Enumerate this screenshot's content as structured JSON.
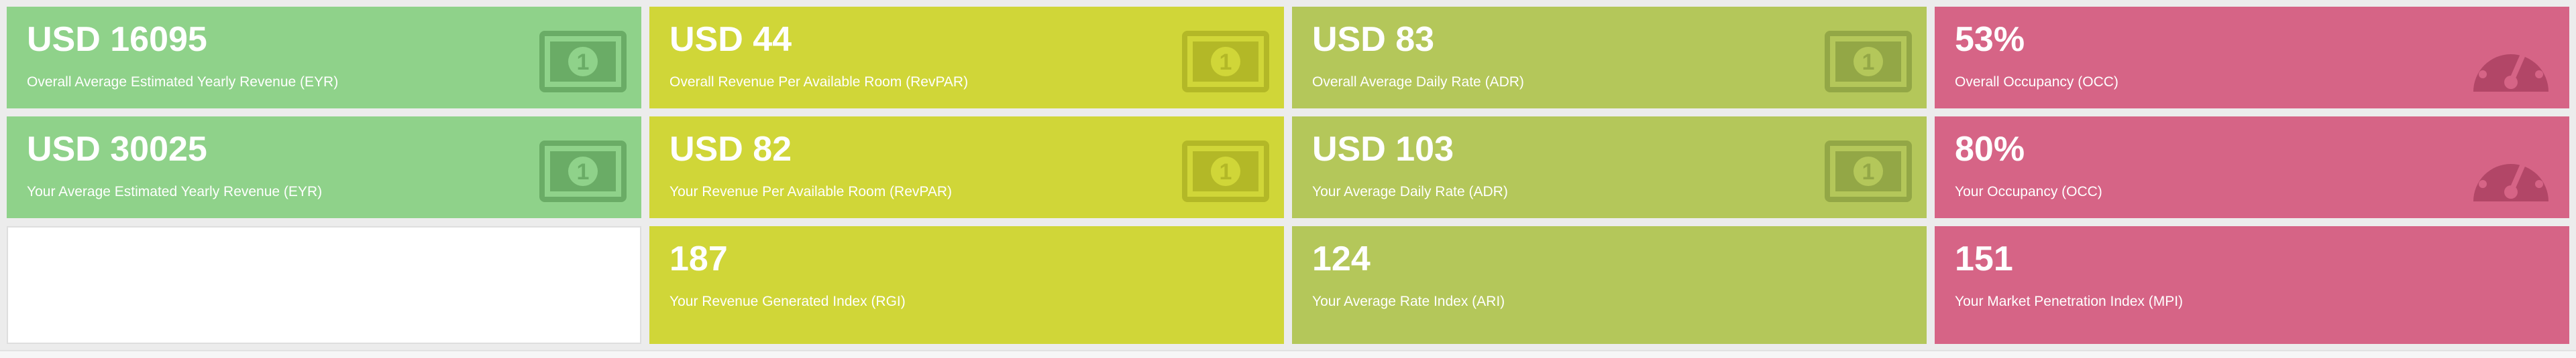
{
  "colors": {
    "green": "#8fd28a",
    "yellow": "#d0d638",
    "olive": "#b4c75a",
    "pink": "#d66486",
    "icon_green": "#6aac66",
    "icon_yellow": "#b3b827",
    "icon_olive": "#93a746",
    "icon_pink": "#b24667"
  },
  "row1": [
    {
      "value": "USD 16095",
      "label": "Overall Average Estimated Yearly Revenue (EYR)",
      "icon": "money-bill-icon"
    },
    {
      "value": "USD 44",
      "label": "Overall Revenue Per Available Room (RevPAR)",
      "icon": "money-bill-icon"
    },
    {
      "value": "USD 83",
      "label": "Overall Average Daily Rate (ADR)",
      "icon": "money-bill-icon"
    },
    {
      "value": "53%",
      "label": "Overall Occupancy (OCC)",
      "icon": "speedometer-icon"
    }
  ],
  "row2": [
    {
      "value": "USD 30025",
      "label": "Your Average Estimated Yearly Revenue (EYR)",
      "icon": "money-bill-icon"
    },
    {
      "value": "USD 82",
      "label": "Your Revenue Per Available Room (RevPAR)",
      "icon": "money-bill-icon"
    },
    {
      "value": "USD 103",
      "label": "Your Average Daily Rate (ADR)",
      "icon": "money-bill-icon"
    },
    {
      "value": "80%",
      "label": "Your Occupancy (OCC)",
      "icon": "speedometer-icon"
    }
  ],
  "row3": [
    {
      "value": "",
      "label": ""
    },
    {
      "value": "187",
      "label": "Your Revenue Generated Index (RGI)"
    },
    {
      "value": "124",
      "label": "Your Average Rate Index (ARI)"
    },
    {
      "value": "151",
      "label": "Your Market Penetration Index (MPI)"
    }
  ]
}
